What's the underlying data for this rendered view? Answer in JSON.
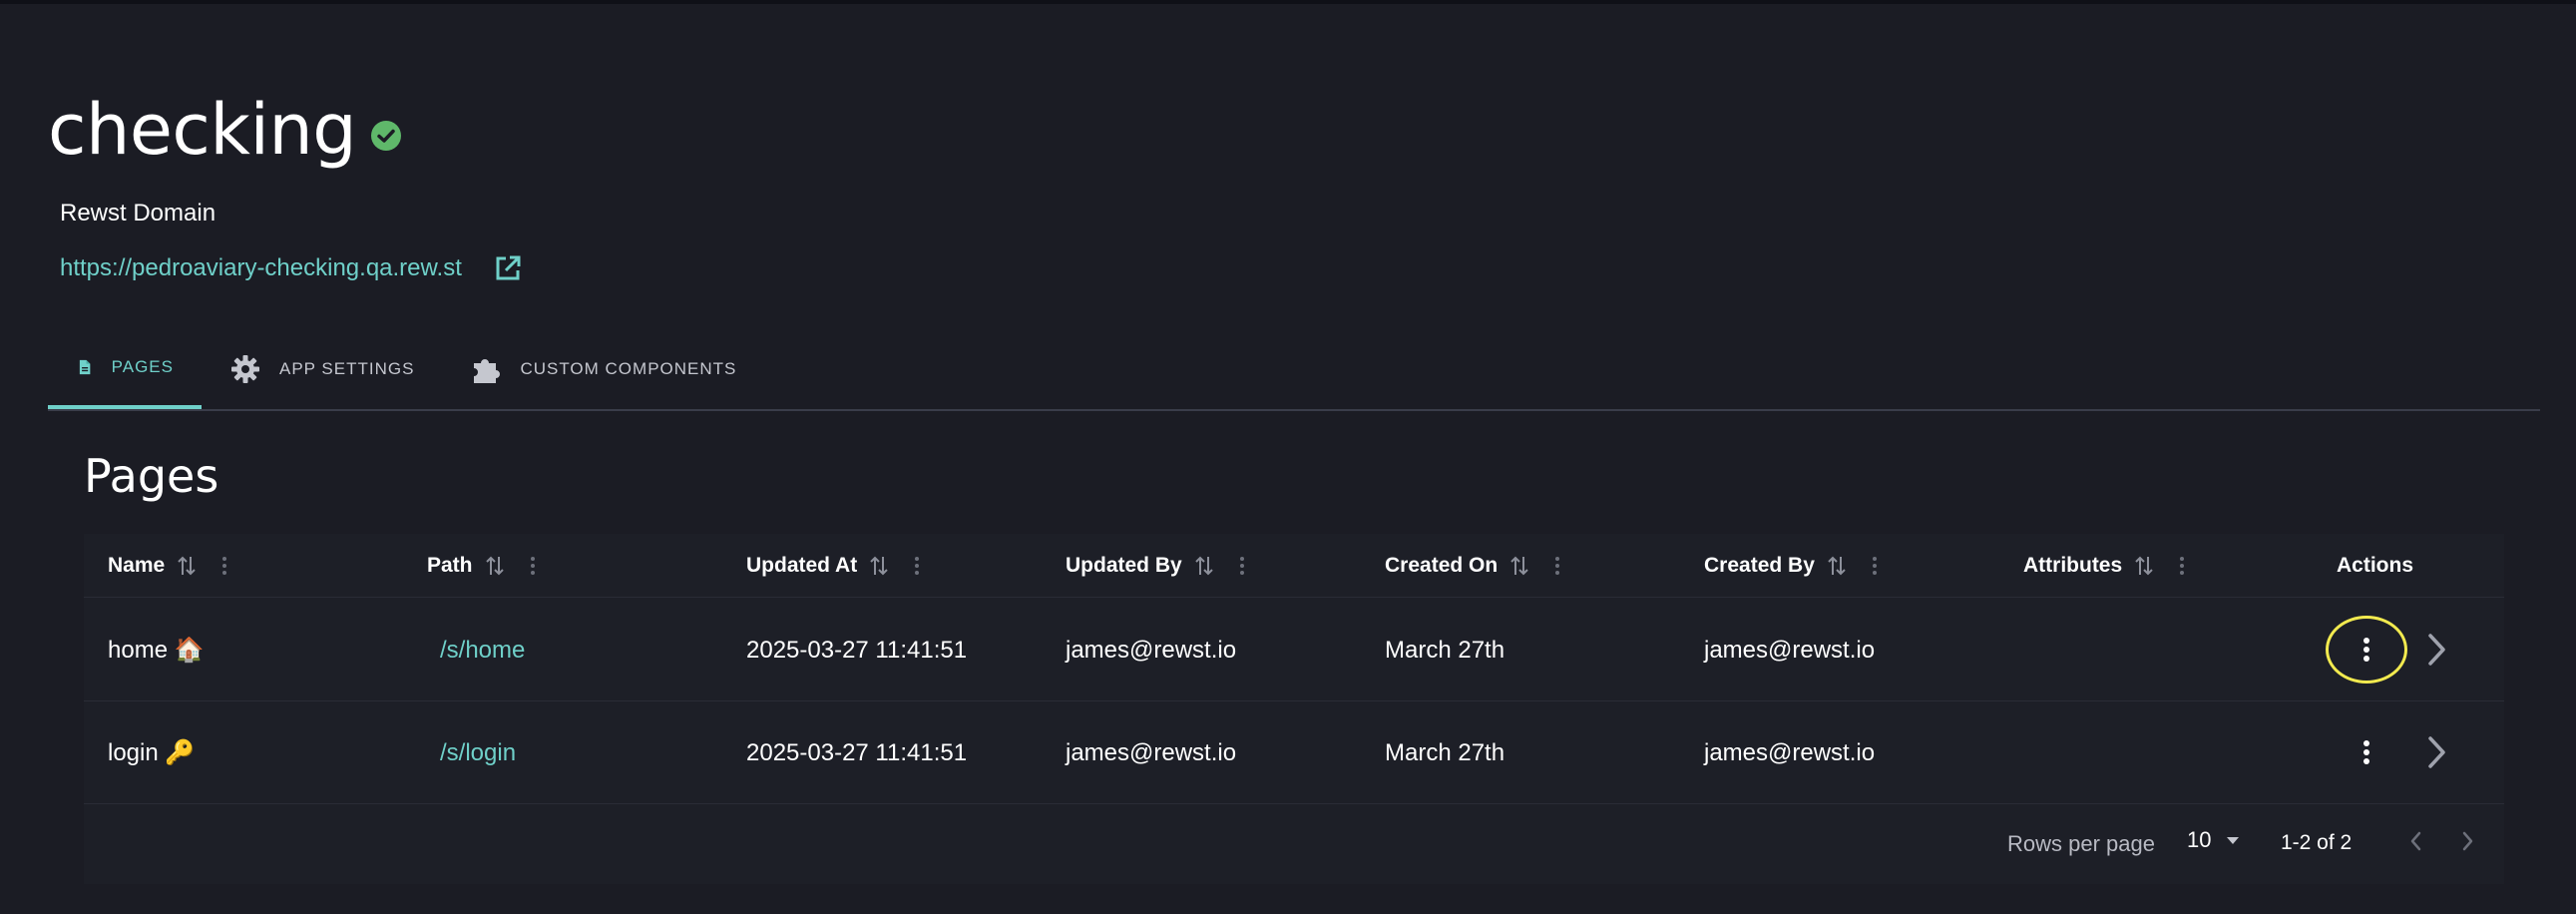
{
  "app": {
    "title": "checking",
    "status": "verified",
    "domain_label": "Rewst Domain",
    "domain_url": "https://pedroaviary-checking.qa.rew.st"
  },
  "tabs": [
    {
      "label": "PAGES",
      "icon": "document-icon",
      "active": true
    },
    {
      "label": "APP SETTINGS",
      "icon": "gear-icon",
      "active": false
    },
    {
      "label": "CUSTOM COMPONENTS",
      "icon": "puzzle-icon",
      "active": false
    }
  ],
  "section_title": "Pages",
  "table": {
    "columns": [
      "Name",
      "Path",
      "Updated At",
      "Updated By",
      "Created On",
      "Created By",
      "Attributes",
      "Actions"
    ],
    "rows": [
      {
        "name": "home 🏠",
        "path": "/s/home",
        "updated_at": "2025-03-27 11:41:51",
        "updated_by": "james@rewst.io",
        "created_on": "March 27th",
        "created_by": "james@rewst.io",
        "attributes": ""
      },
      {
        "name": "login 🔑",
        "path": "/s/login",
        "updated_at": "2025-03-27 11:41:51",
        "updated_by": "james@rewst.io",
        "created_on": "March 27th",
        "created_by": "james@rewst.io",
        "attributes": ""
      }
    ]
  },
  "pagination": {
    "rows_per_page_label": "Rows per page",
    "rows_per_page": "10",
    "range": "1-2 of 2"
  },
  "colors": {
    "accent": "#6fd0c9",
    "success": "#5fb86a",
    "highlight": "#f2ea4f",
    "background": "#1b1c24"
  }
}
